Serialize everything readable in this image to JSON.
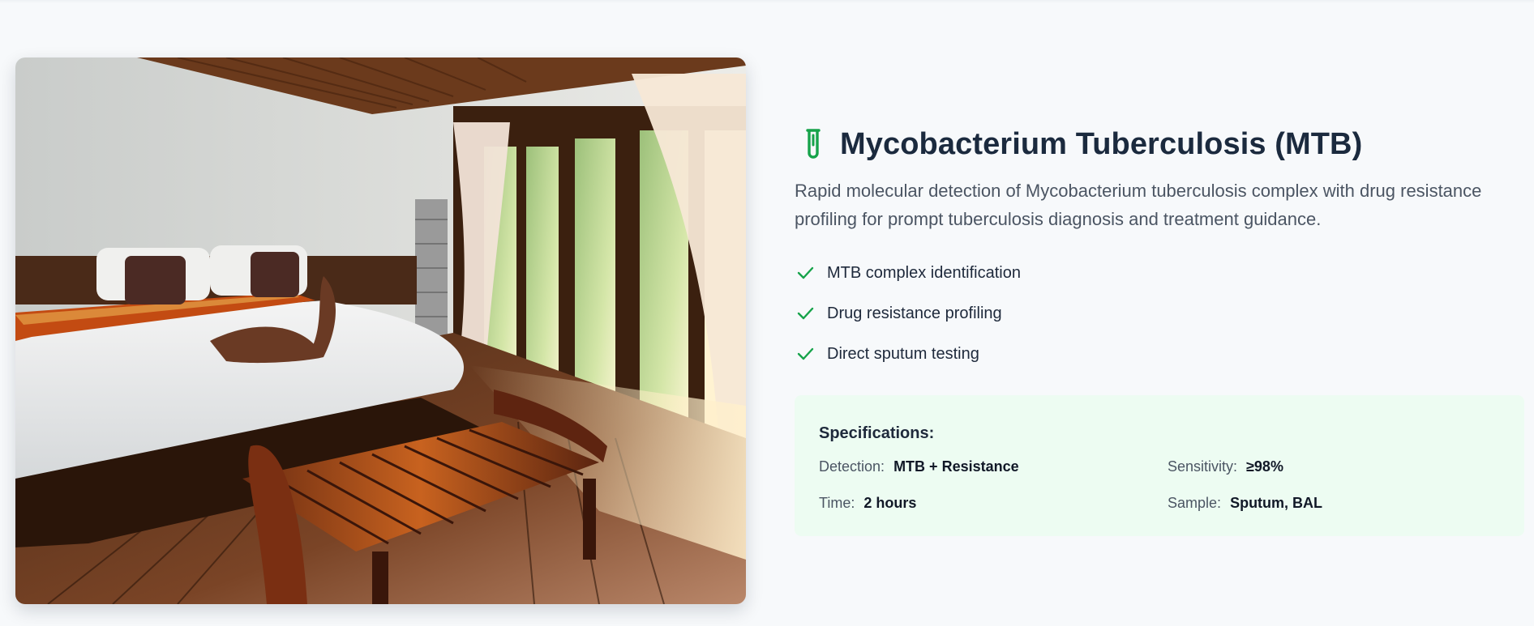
{
  "product": {
    "title": "Mycobacterium Tuberculosis (MTB)",
    "description": "Rapid molecular detection of Mycobacterium tuberculosis complex with drug resistance profiling for prompt tuberculosis diagnosis and treatment guidance.",
    "icon": "test-tube-icon",
    "accent_color": "#16a34a"
  },
  "features": [
    {
      "label": "MTB complex identification",
      "icon": "check-icon"
    },
    {
      "label": "Drug resistance profiling",
      "icon": "check-icon"
    },
    {
      "label": "Direct sputum testing",
      "icon": "check-icon"
    }
  ],
  "specifications": {
    "heading": "Specifications:",
    "detection": {
      "label": "Detection:",
      "value": "MTB + Resistance"
    },
    "sensitivity": {
      "label": "Sensitivity:",
      "value": "≥98%"
    },
    "time": {
      "label": "Time:",
      "value": "2 hours"
    },
    "sample": {
      "label": "Sample:",
      "value": "Sputum, BAL"
    }
  },
  "image": {
    "description_icon": "bedroom-photo"
  }
}
